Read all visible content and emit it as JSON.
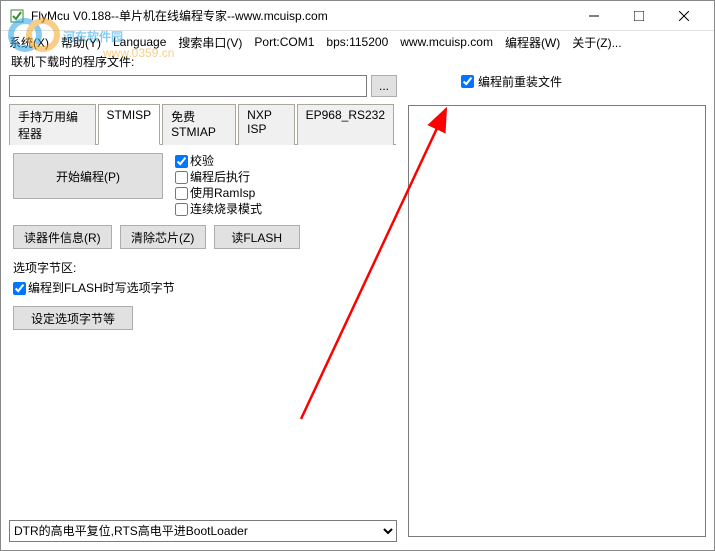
{
  "window": {
    "title": "FlyMcu V0.188--单片机在线编程专家--www.mcuisp.com"
  },
  "menu": {
    "system": "系统(X)",
    "help": "帮助(Y)",
    "language": "Language",
    "search_port": "搜索串口(V)",
    "port": "Port:COM1",
    "bps": "bps:115200",
    "site": "www.mcuisp.com",
    "programmer": "编程器(W)",
    "about": "关于(Z)..."
  },
  "file_section": {
    "label": "联机下载时的程序文件:",
    "path": "",
    "browse": "..."
  },
  "top_check": {
    "label": "编程前重装文件",
    "checked": true
  },
  "tabs": [
    {
      "label": "手持万用编程器",
      "active": false
    },
    {
      "label": "STMISP",
      "active": true
    },
    {
      "label": "免费STMIAP",
      "active": false
    },
    {
      "label": "NXP ISP",
      "active": false
    },
    {
      "label": "EP968_RS232",
      "active": false
    }
  ],
  "stmisp": {
    "start_btn": "开始编程(P)",
    "checks": [
      {
        "label": "校验",
        "checked": true
      },
      {
        "label": "编程后执行",
        "checked": false
      },
      {
        "label": "使用RamIsp",
        "checked": false
      },
      {
        "label": "连续烧录模式",
        "checked": false
      }
    ],
    "btn_read_info": "读器件信息(R)",
    "btn_erase": "清除芯片(Z)",
    "btn_read_flash": "读FLASH",
    "option_area_label": "选项字节区:",
    "option_check": {
      "label": "编程到FLASH时写选项字节",
      "checked": true
    },
    "option_btn": "设定选项字节等"
  },
  "bottom_select": {
    "value": "DTR的高电平复位,RTS高电平进BootLoader"
  },
  "watermark": {
    "brand": "河东软件园",
    "url": "www.0359.cn"
  }
}
